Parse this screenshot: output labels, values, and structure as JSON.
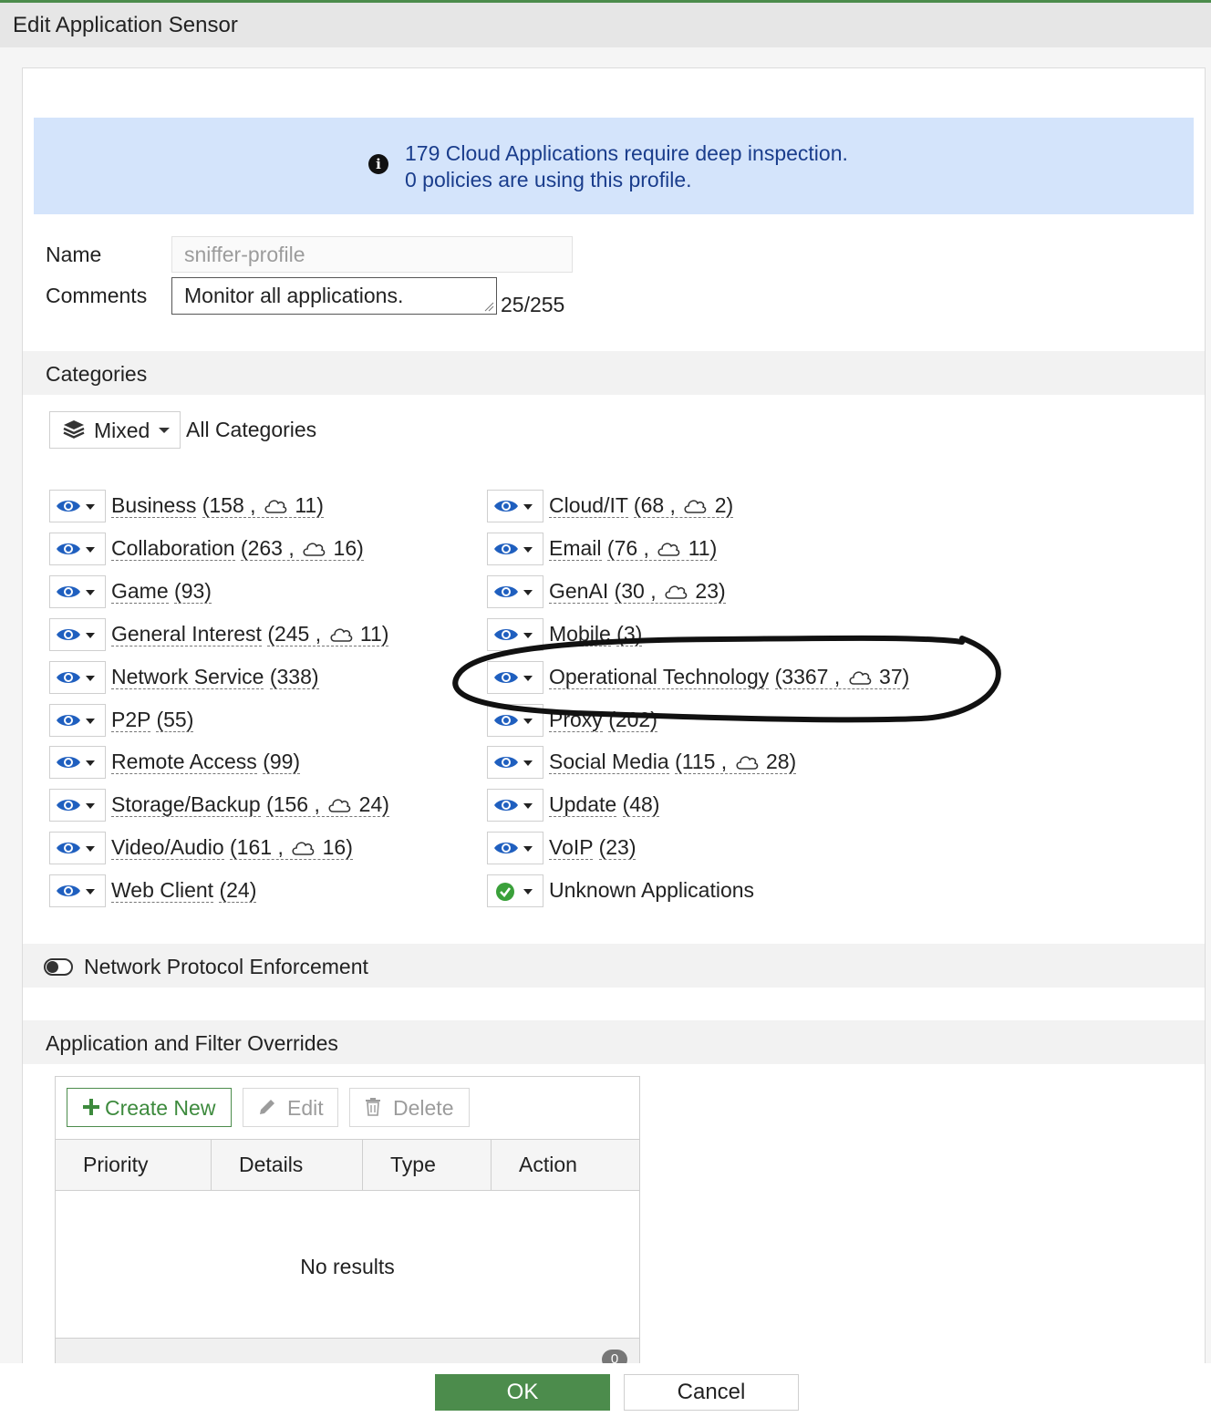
{
  "window": {
    "title": "Edit Application Sensor"
  },
  "info_banner": {
    "line1": "179 Cloud Applications require deep inspection.",
    "line2": "0 policies are using this profile."
  },
  "form": {
    "name_label": "Name",
    "name_value": "sniffer-profile",
    "comments_label": "Comments",
    "comments_value": "Monitor all applications.",
    "char_count": "25/255"
  },
  "categories": {
    "section_title": "Categories",
    "mixed_label": "Mixed",
    "all_categories_label": "All Categories",
    "left_column": [
      {
        "name": "Business",
        "count_text": "(158 , ",
        "cloud": "11)",
        "action": "monitor"
      },
      {
        "name": "Collaboration",
        "count_text": "(263 , ",
        "cloud": "16)",
        "action": "monitor"
      },
      {
        "name": "Game",
        "count_text": "(93)",
        "cloud": null,
        "action": "monitor"
      },
      {
        "name": "General Interest",
        "count_text": "(245 , ",
        "cloud": "11)",
        "action": "monitor"
      },
      {
        "name": "Network Service",
        "count_text": "(338)",
        "cloud": null,
        "action": "monitor"
      },
      {
        "name": "P2P",
        "count_text": "(55)",
        "cloud": null,
        "action": "monitor"
      },
      {
        "name": "Remote Access",
        "count_text": "(99)",
        "cloud": null,
        "action": "monitor"
      },
      {
        "name": "Storage/Backup",
        "count_text": "(156 , ",
        "cloud": "24)",
        "action": "monitor"
      },
      {
        "name": "Video/Audio",
        "count_text": "(161 , ",
        "cloud": "16)",
        "action": "monitor"
      },
      {
        "name": "Web Client",
        "count_text": "(24)",
        "cloud": null,
        "action": "monitor"
      }
    ],
    "right_column": [
      {
        "name": "Cloud/IT",
        "count_text": "(68 , ",
        "cloud": "2)",
        "action": "monitor"
      },
      {
        "name": "Email",
        "count_text": "(76 , ",
        "cloud": "11)",
        "action": "monitor"
      },
      {
        "name": "GenAI",
        "count_text": "(30 , ",
        "cloud": "23)",
        "action": "monitor"
      },
      {
        "name": "Mobile",
        "count_text": "(3)",
        "cloud": null,
        "action": "monitor"
      },
      {
        "name": "Operational Technology",
        "count_text": "(3367 , ",
        "cloud": "37)",
        "action": "monitor"
      },
      {
        "name": "Proxy",
        "count_text": "(202)",
        "cloud": null,
        "action": "monitor"
      },
      {
        "name": "Social Media",
        "count_text": "(115 , ",
        "cloud": "28)",
        "action": "monitor"
      },
      {
        "name": "Update",
        "count_text": "(48)",
        "cloud": null,
        "action": "monitor"
      },
      {
        "name": "VoIP",
        "count_text": "(23)",
        "cloud": null,
        "action": "monitor"
      },
      {
        "name": "Unknown Applications",
        "count_text": "",
        "cloud": null,
        "action": "allow"
      }
    ]
  },
  "network_protocol_enforcement": {
    "label": "Network Protocol Enforcement",
    "enabled": false
  },
  "overrides": {
    "section_title": "Application and Filter Overrides",
    "create_new_label": "Create New",
    "edit_label": "Edit",
    "delete_label": "Delete",
    "columns": [
      "Priority",
      "Details",
      "Type",
      "Action"
    ],
    "empty_text": "No results",
    "count": "0"
  },
  "buttons": {
    "ok_label": "OK",
    "cancel_label": "Cancel"
  },
  "colors": {
    "accent_green": "#4c8c4c",
    "info_banner_bg": "#d4e4fb",
    "info_text": "#1a3d8c",
    "eye_icon": "#1f5fbf",
    "check_icon": "#3aa03a"
  }
}
